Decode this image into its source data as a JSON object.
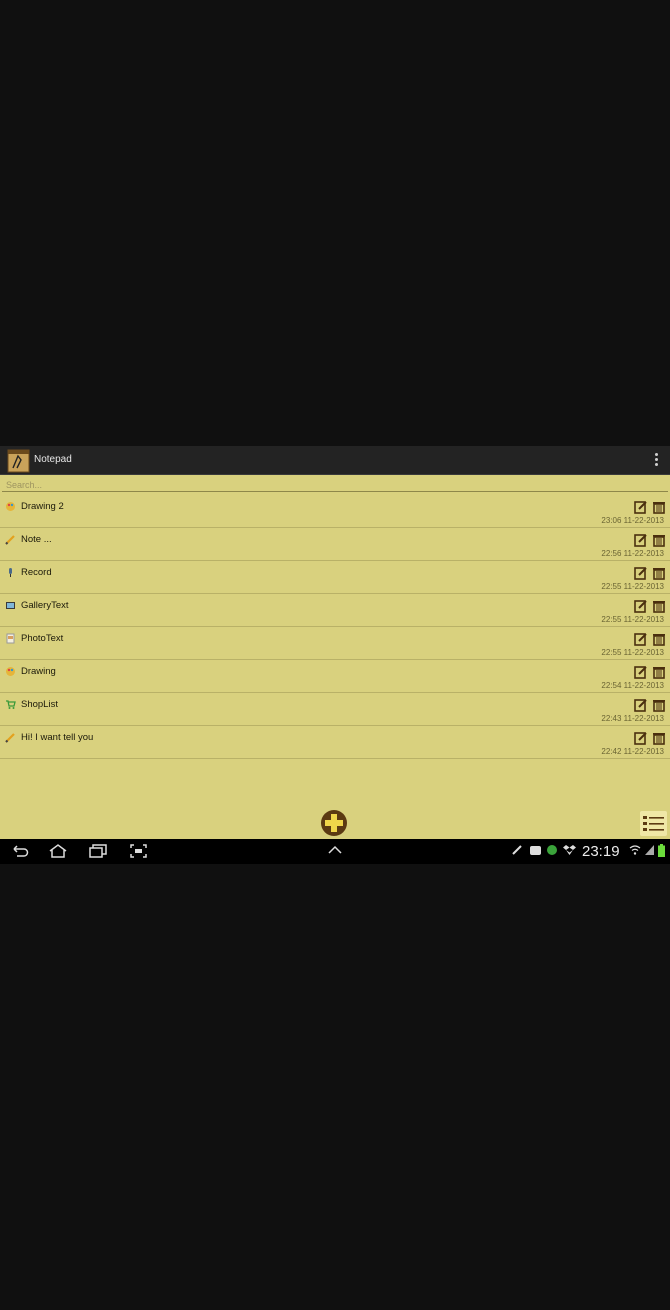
{
  "app": {
    "title": "Notepad"
  },
  "search": {
    "placeholder": "Search..."
  },
  "notes": [
    {
      "title": "Drawing 2",
      "type": "drawing-icon",
      "time": "23:06 11-22-2013"
    },
    {
      "title": "Note ...",
      "type": "pencil-icon",
      "time": "22:56 11-22-2013"
    },
    {
      "title": "Record",
      "type": "microphone-icon",
      "time": "22:55 11-22-2013"
    },
    {
      "title": "GalleryText",
      "type": "gallery-icon",
      "time": "22:55 11-22-2013"
    },
    {
      "title": "PhotoText",
      "type": "photo-icon",
      "time": "22:55 11-22-2013"
    },
    {
      "title": "Drawing",
      "type": "drawing-icon",
      "time": "22:54 11-22-2013"
    },
    {
      "title": "ShopList",
      "type": "cart-icon",
      "time": "22:43 11-22-2013"
    },
    {
      "title": "Hi! I want tell you",
      "type": "pencil-icon",
      "time": "22:42 11-22-2013"
    }
  ],
  "status": {
    "clock": "23:19"
  },
  "colors": {
    "paper": "#d9d17e",
    "accent": "#5b3a12"
  }
}
